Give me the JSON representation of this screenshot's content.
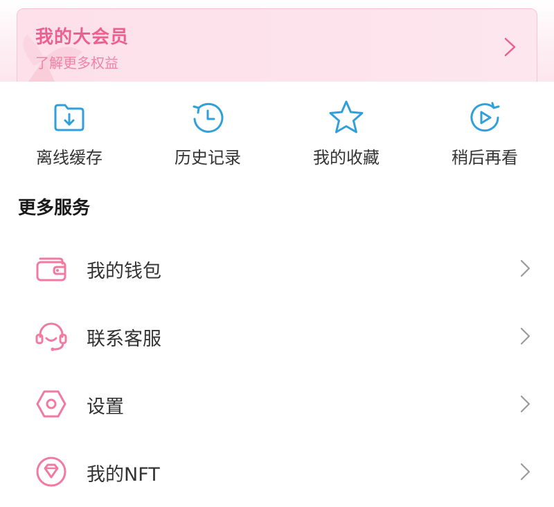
{
  "vip": {
    "title": "我的大会员",
    "subtitle": "了解更多权益",
    "accent": "#ec5f8e"
  },
  "quick_actions": [
    {
      "label": "离线缓存",
      "icon": "download-folder-icon"
    },
    {
      "label": "历史记录",
      "icon": "history-clock-icon"
    },
    {
      "label": "我的收藏",
      "icon": "star-icon"
    },
    {
      "label": "稍后再看",
      "icon": "watch-later-play-icon"
    }
  ],
  "services": {
    "title": "更多服务",
    "items": [
      {
        "label": "我的钱包",
        "icon": "wallet-icon"
      },
      {
        "label": "联系客服",
        "icon": "headset-icon"
      },
      {
        "label": "设置",
        "icon": "settings-hexagon-icon"
      },
      {
        "label": "我的NFT",
        "icon": "diamond-icon"
      }
    ]
  },
  "colors": {
    "quick_icon": "#2fa0da",
    "service_icon": "#f07aa0",
    "chevron": "#9a9a9a"
  }
}
